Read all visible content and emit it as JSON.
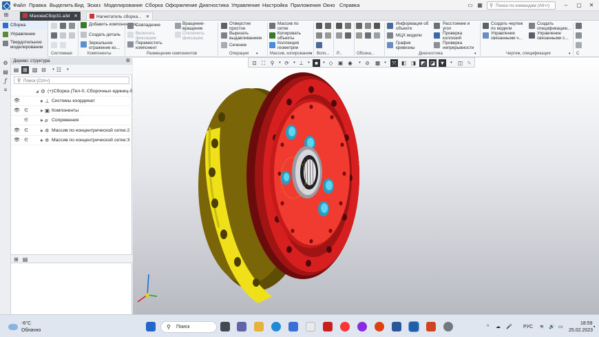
{
  "menubar": {
    "items": [
      "Файл",
      "Правка",
      "Выделить",
      "Вид",
      "Эскиз",
      "Моделирование",
      "Сборка",
      "Оформление",
      "Диагностика",
      "Управление",
      "Настройка",
      "Приложения",
      "Окно",
      "Справка"
    ],
    "search_placeholder": "Поиск по командам (Alt+/)"
  },
  "doc_tabs": [
    {
      "label": "МаховаСбор31.a3d",
      "active": true
    },
    {
      "label": "Нагнетатель сборка...",
      "active": false
    }
  ],
  "ribbon": {
    "modes": [
      "Сборка",
      "Управление",
      "Твердотельное моделирование"
    ],
    "system": {
      "label": "Системная"
    },
    "components": {
      "label": "Компоненты",
      "buttons": [
        "Добавить компонент из...",
        "Создать деталь",
        "Зеркальное отражение ко..."
      ]
    },
    "placement": {
      "label": "Размещение компонентов",
      "buttons": [
        "Совпадение",
        "Включить фиксацию",
        "Переместить компонент",
        "Вращение-вращение",
        "Отключить фиксацию"
      ]
    },
    "operations": {
      "label": "Операции",
      "buttons": [
        "Отверстие простое",
        "Вырезать выдавливанием",
        "Сечение"
      ]
    },
    "array": {
      "label": "Массив, копирование",
      "buttons": [
        "Массив по сетке",
        "Копировать объекты",
        "Коллекция геометрии"
      ]
    },
    "small_groups": [
      "Вспо...",
      "Р...",
      "Обозна..."
    ],
    "diagnostics": {
      "label": "Диагностика",
      "buttons": [
        "Информация об объекте",
        "МЦХ модели",
        "График кривизны",
        "Расстояние и угол",
        "Проверка коллизий",
        "Проверка непрерывности"
      ]
    },
    "drawing": {
      "label": "Чертеж, спецификация",
      "buttons": [
        "Создать чертеж по модели",
        "Управление связанными ч...",
        "Создать спецификацию...",
        "Управление связанными с..."
      ]
    },
    "overflow_label": "С"
  },
  "tree": {
    "header": "Дерево: структура",
    "search_placeholder": "Поиск (Ctrl+/)",
    "rows": [
      {
        "label": "(+)Сборка (Тел-0, Сборочных единиц-0",
        "eye": false
      },
      {
        "label": "Системы координат",
        "eye": true
      },
      {
        "label": "Компоненты",
        "eye": true
      },
      {
        "label": "Сопряжения",
        "eye": false
      },
      {
        "label": "Массив по концентрической сетке:2",
        "eye": true
      },
      {
        "label": "Массив по концентрической сетке:3",
        "eye": true
      }
    ]
  },
  "taskbar": {
    "weather_temp": "-6°C",
    "weather_desc": "Облачно",
    "search_label": "Поиск",
    "language": "РУС",
    "time": "18:59",
    "date": "25.02.2023"
  },
  "colors": {
    "flange_red": "#d81f1f",
    "hub_red": "#f23b30",
    "housing_olive": "#7a6508",
    "housing_yellow": "#efe01a",
    "bolt_cyan": "#5ed4f0",
    "ui_dark": "#3b3f46"
  }
}
